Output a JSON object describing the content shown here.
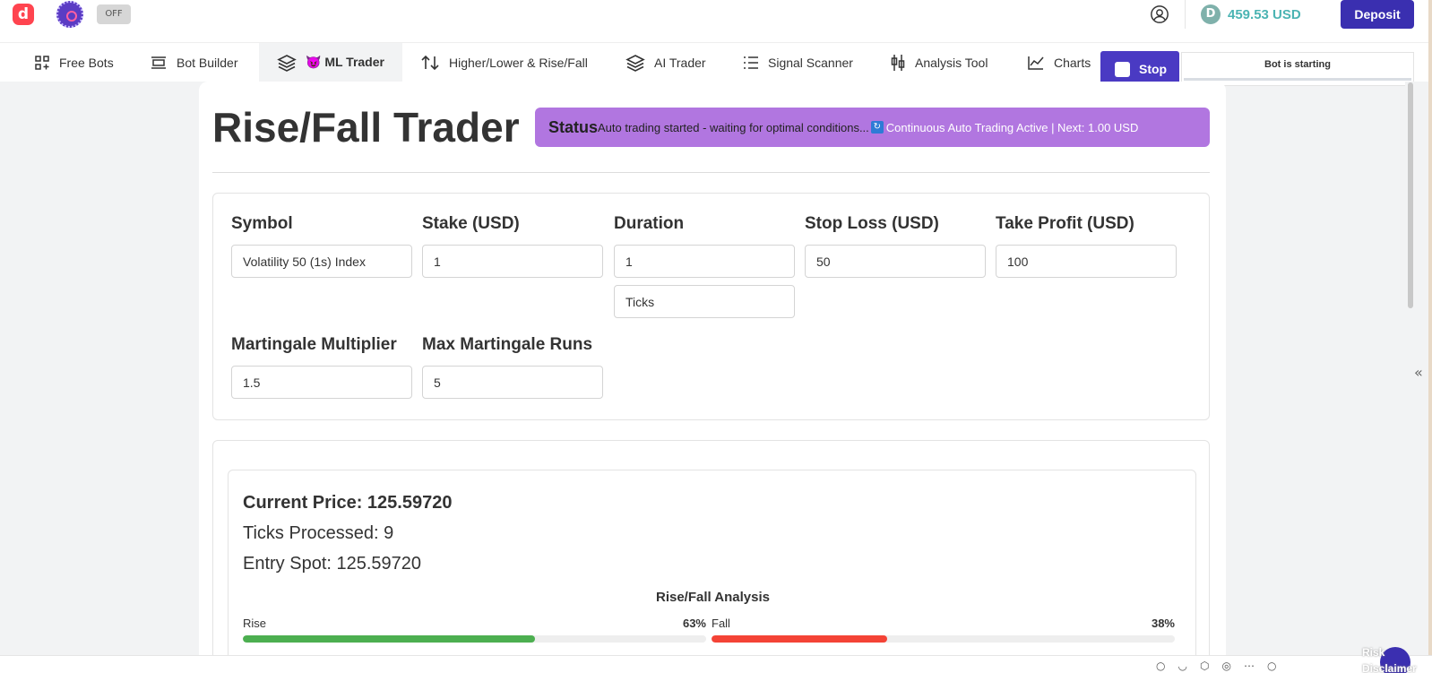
{
  "header": {
    "logo_letter": "d",
    "toggle_label": "OFF",
    "balance": "459.53 USD",
    "currency_icon": "D",
    "deposit_label": "Deposit"
  },
  "nav": {
    "tabs": [
      {
        "label": "Free Bots",
        "icon": "grid-plus-icon"
      },
      {
        "label": "Bot Builder",
        "icon": "builder-icon"
      },
      {
        "label": "😈 ML Trader",
        "icon": "layers-icon",
        "active": true
      },
      {
        "label": "Higher/Lower & Rise/Fall",
        "icon": "swap-vertical-icon"
      },
      {
        "label": "AI Trader",
        "icon": "layers-icon"
      },
      {
        "label": "Signal Scanner",
        "icon": "list-icon"
      },
      {
        "label": "Analysis Tool",
        "icon": "candlestick-icon"
      },
      {
        "label": "Charts",
        "icon": "line-chart-icon"
      }
    ],
    "stop_label": "Stop",
    "bot_status": "Bot is starting"
  },
  "trader": {
    "title": "Rise/Fall Trader",
    "status_label": "Status",
    "status_message": "Auto trading started - waiting for optimal conditions...",
    "status_icon": "🔄",
    "status_active": "Continuous Auto Trading Active | Next: 1.00 USD"
  },
  "settings": {
    "symbol": {
      "label": "Symbol",
      "value": "Volatility 50 (1s) Index"
    },
    "stake": {
      "label": "Stake (USD)",
      "value": "1"
    },
    "duration": {
      "label": "Duration",
      "value": "1",
      "unit": "Ticks"
    },
    "stop_loss": {
      "label": "Stop Loss (USD)",
      "value": "50"
    },
    "take_profit": {
      "label": "Take Profit (USD)",
      "value": "100"
    },
    "martingale_multiplier": {
      "label": "Martingale Multiplier",
      "value": "1.5"
    },
    "max_martingale_runs": {
      "label": "Max Martingale Runs",
      "value": "5"
    }
  },
  "analysis": {
    "current_price": "Current Price: 125.59720",
    "ticks_processed": "Ticks Processed: 9",
    "entry_spot": "Entry Spot: 125.59720",
    "title": "Rise/Fall Analysis",
    "rise": {
      "label": "Rise",
      "pct_label": "63%",
      "value": 0.63,
      "color": "#4caf50"
    },
    "fall": {
      "label": "Fall",
      "pct_label": "38%",
      "value": 0.38,
      "color": "#f44336"
    }
  },
  "risk": {
    "label": "Risk Disclaimer"
  },
  "colors": {
    "brand_red": "#ff444f",
    "accent_purple": "#4a3ac3",
    "status_purple": "#b176e0",
    "balance_teal": "#4bb4b3"
  }
}
